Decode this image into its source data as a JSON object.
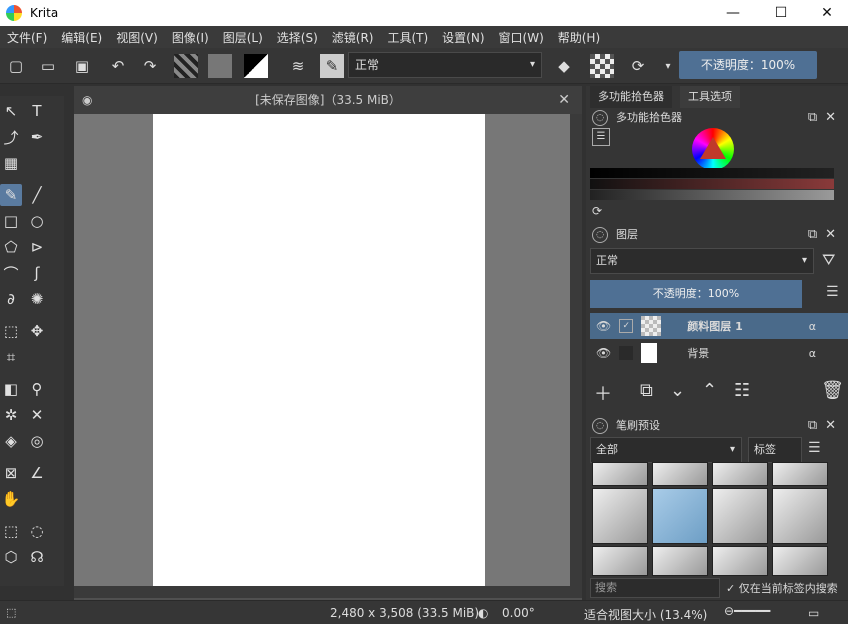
{
  "window": {
    "title": "Krita",
    "controls": {
      "minimize": "—",
      "maximize": "☐",
      "close": "✕"
    }
  },
  "menu": [
    "文件(F)",
    "编辑(E)",
    "视图(V)",
    "图像(I)",
    "图层(L)",
    "选择(S)",
    "滤镜(R)",
    "工具(T)",
    "设置(N)",
    "窗口(W)",
    "帮助(H)"
  ],
  "toolbar": {
    "blend_mode": "正常",
    "opacity": "不透明度：100%"
  },
  "document": {
    "tab_title": "[未保存图像]（33.5 MiB）"
  },
  "dock": {
    "tabs": [
      "多功能拾色器",
      "工具选项"
    ],
    "color_panel_title": "多功能拾色器",
    "layers_title": "图层",
    "layers_blend": "正常",
    "layers_opacity": "不透明度：100%",
    "layers": [
      {
        "name": "颜料图层 1",
        "selected": true
      },
      {
        "name": "背景",
        "selected": false
      }
    ],
    "brush_title": "笔刷预设",
    "brush_filter": "全部",
    "brush_tag": "标签",
    "search_placeholder": "搜索",
    "search_in_tag": "仅在当前标签内搜索"
  },
  "status": {
    "dimensions": "2,480 x 3,508 (33.5 MiB)",
    "rotation": "0.00°",
    "zoom": "适合视图大小 (13.4%)"
  },
  "colors": {
    "accent": "#5a7ba0",
    "opacity_bar": "#4f7094",
    "canvas_bg": "#777777"
  }
}
